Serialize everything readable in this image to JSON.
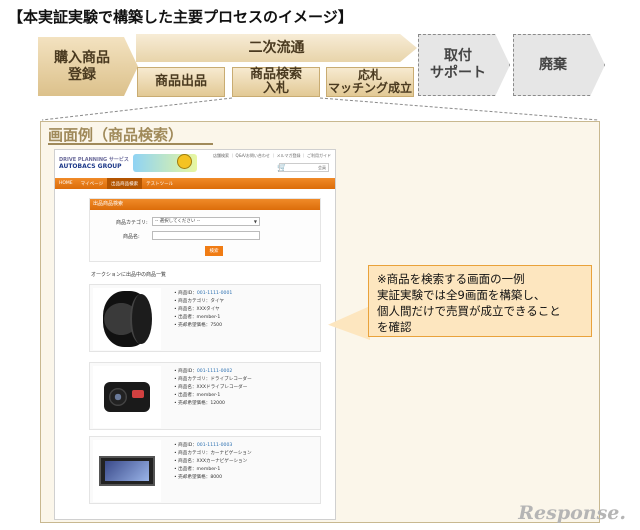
{
  "title": "【本実証実験で構築した主要プロセスのイメージ】",
  "flow": {
    "registration": [
      "購入商品",
      "登録"
    ],
    "secondary": "二次流通",
    "listing": "商品出品",
    "search_bid": [
      "商品検索",
      "入札"
    ],
    "match": [
      "応札",
      "マッチング成立"
    ],
    "support": [
      "取付",
      "サポート"
    ],
    "disposal": "廃棄"
  },
  "example_title": "画面例（商品検索）",
  "website": {
    "logo_line1": "DRIVE PLANNING サービス",
    "logo_line2": "AUTOBACS GROUP",
    "top_links": "店舗検索 ｜ Q&A/お問い合わせ ｜ メルマガ登録 ｜ ご利用ガイド",
    "user_label": "会員",
    "nav": [
      "HOME",
      "マイページ",
      "出品商品検索",
      "テストツール"
    ],
    "search_panel": {
      "heading": "出品商品検索",
      "category_label": "商品カテゴリ:",
      "category_value": "-- 選択してください --",
      "name_label": "商品名:",
      "search_button": "検索"
    },
    "list_heading": "オークションに出品中の商品一覧",
    "items": [
      {
        "id_label": "商品ID：",
        "id": "001-1111-0001",
        "category": "商品カテゴリ：タイヤ",
        "name": "商品名：XXXタイヤ",
        "seller": "出品者：member-1",
        "price": "売却希望価格：7500"
      },
      {
        "id_label": "商品ID：",
        "id": "001-1111-0002",
        "category": "商品カテゴリ：ドライブレコーダー",
        "name": "商品名：XXXドライブレコーダー",
        "seller": "出品者：member-1",
        "price": "売却希望価格：12000"
      },
      {
        "id_label": "商品ID：",
        "id": "001-1111-0003",
        "category": "商品カテゴリ：カーナビゲーション",
        "name": "商品名：XXXカーナビゲーション",
        "seller": "出品者：member-1",
        "price": "売却希望価格：8000"
      }
    ]
  },
  "note": [
    "※商品を検索する画面の一例",
    "実証実験では全9画面を構築し、",
    "個人間だけで売買が成立できること",
    "を確認"
  ],
  "watermark": "Response."
}
